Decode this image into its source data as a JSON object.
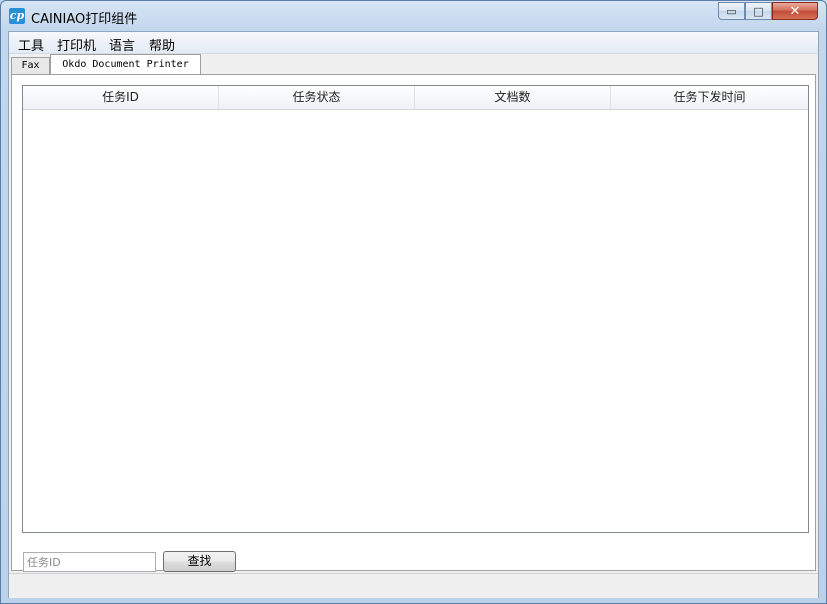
{
  "window": {
    "title": "CAINIAO打印组件",
    "icon": "printer-app-icon",
    "icon_glyph": "cp",
    "minimize_glyph": "▭",
    "maximize_glyph": "□",
    "close_glyph": "✕"
  },
  "menu": {
    "items": [
      "工具",
      "打印机",
      "语言",
      "帮助"
    ]
  },
  "tabs": [
    {
      "label": "Fax"
    },
    {
      "label": "Okdo Document Printer"
    }
  ],
  "table": {
    "columns": [
      "任务ID",
      "任务状态",
      "文档数",
      "任务下发时间"
    ],
    "rows": []
  },
  "search": {
    "placeholder": "任务ID",
    "value": "",
    "button_label": "查找"
  }
}
